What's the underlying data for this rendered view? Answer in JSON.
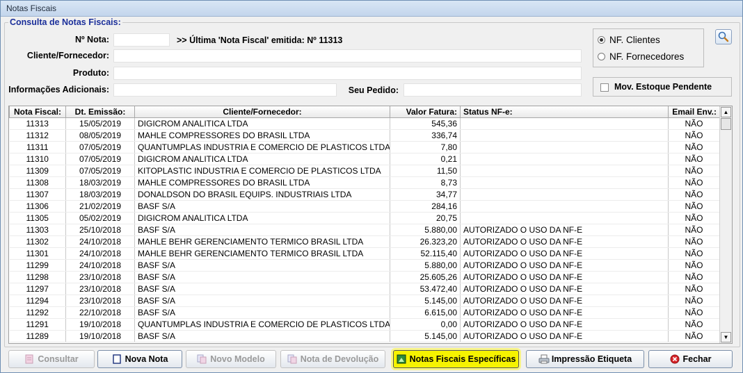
{
  "window": {
    "title": "Notas Fiscais"
  },
  "group": {
    "legend": "Consulta de Notas Fiscais:"
  },
  "form": {
    "nota_label": "Nº Nota:",
    "nota_value": "",
    "ultima_text": ">> Última 'Nota Fiscal' emitida: Nº 11313",
    "cliente_label": "Cliente/Fornecedor:",
    "cliente_value": "",
    "produto_label": "Produto:",
    "produto_value": "",
    "info_label": "Informações Adicionais:",
    "info_value": "",
    "pedido_label": "Seu Pedido:",
    "pedido_value": ""
  },
  "radios": {
    "clientes": "NF. Clientes",
    "fornecedores": "NF. Fornecedores",
    "selected": "clientes"
  },
  "checkbox": {
    "label": "Mov. Estoque Pendente",
    "checked": false
  },
  "table": {
    "headers": [
      "Nota Fiscal:",
      "Dt. Emissão:",
      "Cliente/Fornecedor:",
      "Valor Fatura:",
      "Status NF-e:",
      "Email Env.:"
    ],
    "rows": [
      [
        "11313",
        "15/05/2019",
        "DIGICROM ANALITICA LTDA",
        "545,36",
        "",
        "NÃO"
      ],
      [
        "11312",
        "08/05/2019",
        "MAHLE COMPRESSORES DO BRASIL LTDA",
        "336,74",
        "",
        "NÃO"
      ],
      [
        "11311",
        "07/05/2019",
        "QUANTUMPLAS INDUSTRIA E COMERCIO DE PLASTICOS LTDA",
        "7,80",
        "",
        "NÃO"
      ],
      [
        "11310",
        "07/05/2019",
        "DIGICROM ANALITICA LTDA",
        "0,21",
        "",
        "NÃO"
      ],
      [
        "11309",
        "07/05/2019",
        "KITOPLASTIC INDUSTRIA E COMERCIO DE PLASTICOS LTDA",
        "11,50",
        "",
        "NÃO"
      ],
      [
        "11308",
        "18/03/2019",
        "MAHLE COMPRESSORES DO BRASIL LTDA",
        "8,73",
        "",
        "NÃO"
      ],
      [
        "11307",
        "18/03/2019",
        "DONALDSON DO BRASIL EQUIPS. INDUSTRIAIS LTDA",
        "34,77",
        "",
        "NÃO"
      ],
      [
        "11306",
        "21/02/2019",
        "BASF S/A",
        "284,16",
        "",
        "NÃO"
      ],
      [
        "11305",
        "05/02/2019",
        "DIGICROM ANALITICA LTDA",
        "20,75",
        "",
        "NÃO"
      ],
      [
        "11303",
        "25/10/2018",
        "BASF S/A",
        "5.880,00",
        "AUTORIZADO O USO DA NF-E",
        "NÃO"
      ],
      [
        "11302",
        "24/10/2018",
        "MAHLE BEHR GERENCIAMENTO TERMICO BRASIL LTDA",
        "26.323,20",
        "AUTORIZADO O USO DA NF-E",
        "NÃO"
      ],
      [
        "11301",
        "24/10/2018",
        "MAHLE BEHR GERENCIAMENTO TERMICO BRASIL LTDA",
        "52.115,40",
        "AUTORIZADO O USO DA NF-E",
        "NÃO"
      ],
      [
        "11299",
        "24/10/2018",
        "BASF S/A",
        "5.880,00",
        "AUTORIZADO O USO DA NF-E",
        "NÃO"
      ],
      [
        "11298",
        "23/10/2018",
        "BASF S/A",
        "25.605,26",
        "AUTORIZADO O USO DA NF-E",
        "NÃO"
      ],
      [
        "11297",
        "23/10/2018",
        "BASF S/A",
        "53.472,40",
        "AUTORIZADO O USO DA NF-E",
        "NÃO"
      ],
      [
        "11294",
        "23/10/2018",
        "BASF S/A",
        "5.145,00",
        "AUTORIZADO O USO DA NF-E",
        "NÃO"
      ],
      [
        "11292",
        "22/10/2018",
        "BASF S/A",
        "6.615,00",
        "AUTORIZADO O USO DA NF-E",
        "NÃO"
      ],
      [
        "11291",
        "19/10/2018",
        "QUANTUMPLAS INDUSTRIA E COMERCIO DE PLASTICOS LTDA",
        "0,00",
        "AUTORIZADO O USO DA NF-E",
        "NÃO"
      ],
      [
        "11289",
        "19/10/2018",
        "BASF S/A",
        "5.145,00",
        "AUTORIZADO O USO DA NF-E",
        "NÃO"
      ]
    ]
  },
  "buttons": {
    "consultar": "Consultar",
    "nova_nota": "Nova Nota",
    "novo_modelo": "Novo Modelo",
    "nota_devolucao": "Nota de Devolução",
    "notas_especificas": "Notas Fiscais Específicas",
    "impressao_etiqueta": "Impressão Etiqueta",
    "fechar": "Fechar"
  }
}
